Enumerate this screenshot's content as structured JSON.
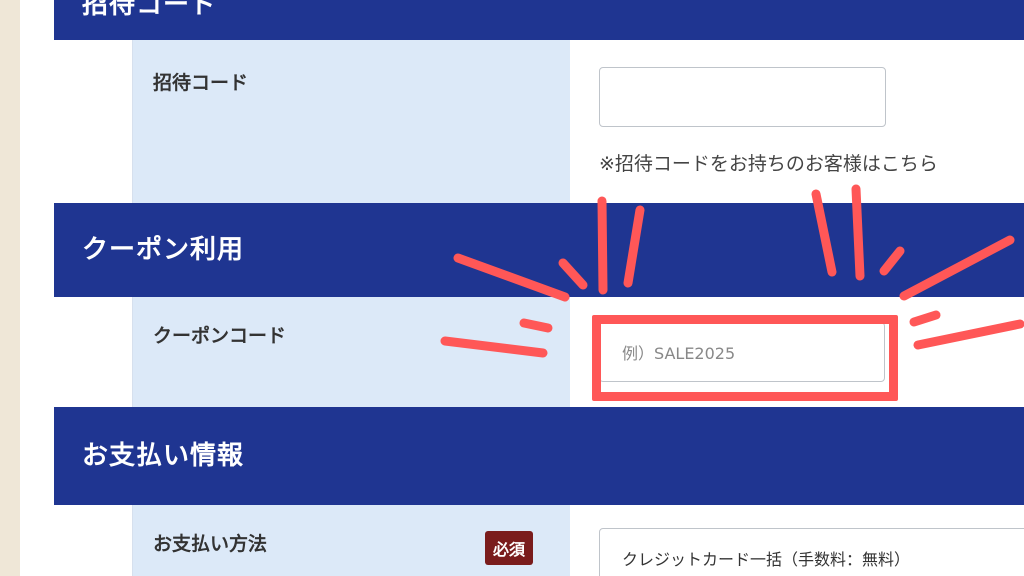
{
  "sections": {
    "invite": {
      "header": "招待コード",
      "label": "招待コード",
      "input_value": "",
      "note": "※招待コードをお持ちのお客様はこちら"
    },
    "coupon": {
      "header": "クーポン利用",
      "label": "クーポンコード",
      "input_placeholder": "例）SALE2025"
    },
    "payment": {
      "header": "お支払い情報",
      "label": "お支払い方法",
      "required_badge": "必須",
      "method_value": "クレジットカード一括（手数料：無料）"
    }
  },
  "colors": {
    "header_bg": "#1f3591",
    "label_bg": "#dce9f8",
    "highlight": "#ff5757",
    "badge_bg": "#7a1c1c"
  }
}
